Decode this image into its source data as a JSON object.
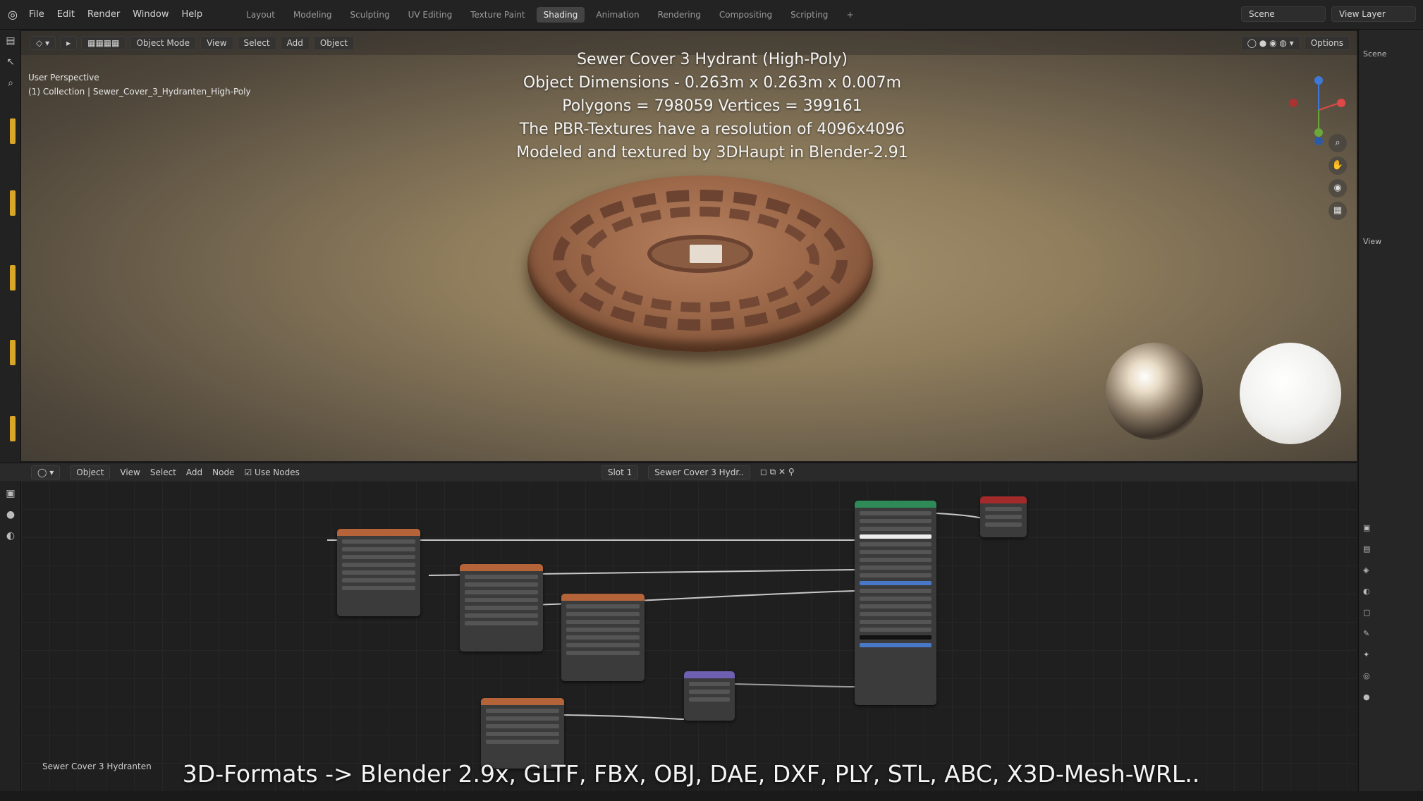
{
  "topbar": {
    "menus": [
      "File",
      "Edit",
      "Render",
      "Window",
      "Help"
    ],
    "workspaces": [
      "Layout",
      "Modeling",
      "Sculpting",
      "UV Editing",
      "Texture Paint",
      "Shading",
      "Animation",
      "Rendering",
      "Compositing",
      "Scripting"
    ],
    "active_workspace": "Shading",
    "add_tab": "+",
    "scene_label": "Scene",
    "view_layer_label": "View Layer"
  },
  "viewport": {
    "mode": "Object Mode",
    "menus": [
      "View",
      "Select",
      "Add",
      "Object"
    ],
    "perspective": "User Perspective",
    "collection_path": "(1) Collection | Sewer_Cover_3_Hydranten_High-Poly",
    "options_label": "Options",
    "overlay_lines": [
      "Sewer Cover 3 Hydrant (High-Poly)",
      "Object Dimensions - 0.263m x 0.263m x 0.007m",
      "Polygons = 798059  Vertices = 399161",
      "The PBR-Textures have a resolution of 4096x4096",
      "Modeled and textured by 3DHaupt in Blender-2.91"
    ]
  },
  "node_editor": {
    "type_label": "Object",
    "menus": [
      "View",
      "Select",
      "Add",
      "Node"
    ],
    "use_nodes_label": "Use Nodes",
    "slot": "Slot 1",
    "material_name": "Sewer Cover 3 Hydr..",
    "editor_footer_name": "Sewer Cover 3 Hydranten"
  },
  "right_panel": {
    "scene_label": "Scene",
    "view_label": "View"
  },
  "bottom_banner": "3D-Formats -> Blender 2.9x, GLTF, FBX, OBJ, DAE, DXF, PLY, STL, ABC, X3D-Mesh-WRL..",
  "colors": {
    "accent": "#d9a628",
    "active_tab": "#444444",
    "principled_header": "#2e8b57",
    "output_header": "#a32a2a",
    "texture_header": "#b5643a",
    "mapping_header": "#6f5fb0"
  }
}
